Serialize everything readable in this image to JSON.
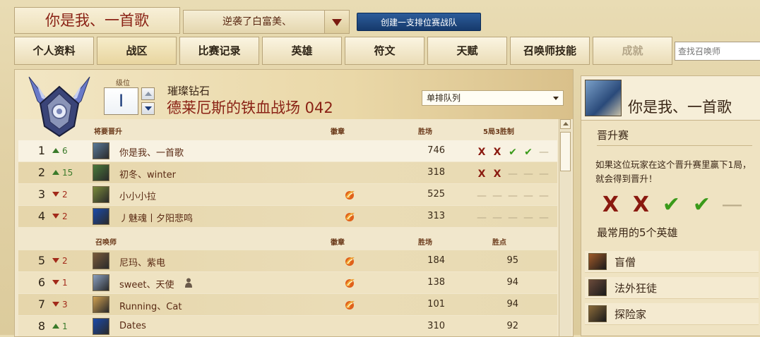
{
  "header": {
    "title": "你是我、一首歌",
    "team_select": "逆袭了白富美、",
    "create_team_label": "创建一支排位赛战队"
  },
  "tabs": [
    {
      "label": "个人资料"
    },
    {
      "label": "战区"
    },
    {
      "label": "比赛记录"
    },
    {
      "label": "英雄"
    },
    {
      "label": "符文"
    },
    {
      "label": "天赋"
    },
    {
      "label": "召唤师技能"
    },
    {
      "label": "成就"
    }
  ],
  "search": {
    "placeholder": "查找召唤师"
  },
  "league": {
    "level_label": "级位",
    "level_value": "I",
    "tier": "璀璨钻石",
    "division": "德莱厄斯的铁血战场 042",
    "queue": "单排队列"
  },
  "promo_table": {
    "headers": {
      "section": "将要晋升",
      "badge": "徽章",
      "wins": "胜场",
      "series": "5局3胜制"
    },
    "rows": [
      {
        "rank": "1",
        "change": "6",
        "dir": "up",
        "name": "你是我、一首歌",
        "badge": false,
        "wins": "746",
        "series": [
          "x",
          "x",
          "v",
          "v",
          "-"
        ],
        "avatar_color": "#5a7a9a"
      },
      {
        "rank": "2",
        "change": "15",
        "dir": "up",
        "name": "初冬、winter",
        "badge": false,
        "wins": "318",
        "series": [
          "x",
          "x",
          "-",
          "-",
          "-"
        ],
        "avatar_color": "#4a7a3a"
      },
      {
        "rank": "3",
        "change": "2",
        "dir": "down",
        "name": "小小小拉",
        "badge": true,
        "wins": "525",
        "series": [
          "-",
          "-",
          "-",
          "-",
          "-"
        ],
        "avatar_color": "#7a8a3a"
      },
      {
        "rank": "4",
        "change": "2",
        "dir": "down",
        "name": "丿魅魂丨夕阳悲鸣",
        "badge": true,
        "wins": "313",
        "series": [
          "-",
          "-",
          "-",
          "-",
          "-"
        ],
        "avatar_color": "#1a4aaa"
      }
    ]
  },
  "summoner_table": {
    "headers": {
      "section": "召唤师",
      "badge": "徽章",
      "wins": "胜场",
      "points": "胜点"
    },
    "rows": [
      {
        "rank": "5",
        "change": "2",
        "dir": "down",
        "name": "尼玛、紫电",
        "badge": true,
        "wins": "184",
        "points": "95",
        "avatar_color": "#7a5a3a",
        "person": false
      },
      {
        "rank": "6",
        "change": "1",
        "dir": "down",
        "name": "sweet、天使",
        "badge": true,
        "wins": "138",
        "points": "94",
        "avatar_color": "#8aa0c0",
        "person": true
      },
      {
        "rank": "7",
        "change": "3",
        "dir": "down",
        "name": "Running、Cat",
        "badge": true,
        "wins": "101",
        "points": "94",
        "avatar_color": "#d0a050",
        "person": false
      },
      {
        "rank": "8",
        "change": "1",
        "dir": "up",
        "name": "Dates",
        "badge": false,
        "wins": "310",
        "points": "92",
        "avatar_color": "#1a4aaa",
        "person": false
      }
    ]
  },
  "side": {
    "name": "你是我、一首歌",
    "promo_title": "晋升赛",
    "promo_desc": "如果这位玩家在这个晋升赛里赢下1局，就会得到晋升！",
    "series": [
      "x",
      "x",
      "v",
      "v",
      "-"
    ],
    "champs_title": "最常用的5个英雄",
    "champions": [
      {
        "name": "盲僧",
        "color": "#a05a2a"
      },
      {
        "name": "法外狂徒",
        "color": "#6a4a3a"
      },
      {
        "name": "探险家",
        "color": "#8a6a3a"
      }
    ]
  },
  "colors": {
    "accent_red": "#8a2215",
    "win_green": "#3a9a1a",
    "loss_red": "#8a1a10",
    "button_blue": "#163a6c"
  }
}
